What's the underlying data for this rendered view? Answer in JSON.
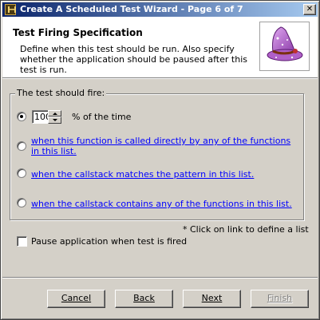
{
  "window": {
    "title": "Create A Scheduled Test Wizard - Page 6 of 7",
    "close_label": "✕"
  },
  "header": {
    "title": "Test Firing Specification",
    "description": "Define when this test should be run.  Also specify whether the application should be paused after this test is run."
  },
  "group": {
    "label": "The test should fire:",
    "percent_value": "100",
    "percent_label": "% of the time",
    "selected_option": "percent",
    "options": [
      {
        "text": "when this function is called directly by any of the functions in this list."
      },
      {
        "text": "when the callstack matches the pattern in this list."
      },
      {
        "text": "when the callstack contains any of the functions in this list."
      }
    ]
  },
  "note": "* Click on link to define a list",
  "pause_checkbox": {
    "label": "Pause application when test is fired",
    "checked": false
  },
  "buttons": {
    "cancel": "Cancel",
    "back": "Back",
    "next": "Next",
    "finish": "Finish"
  }
}
